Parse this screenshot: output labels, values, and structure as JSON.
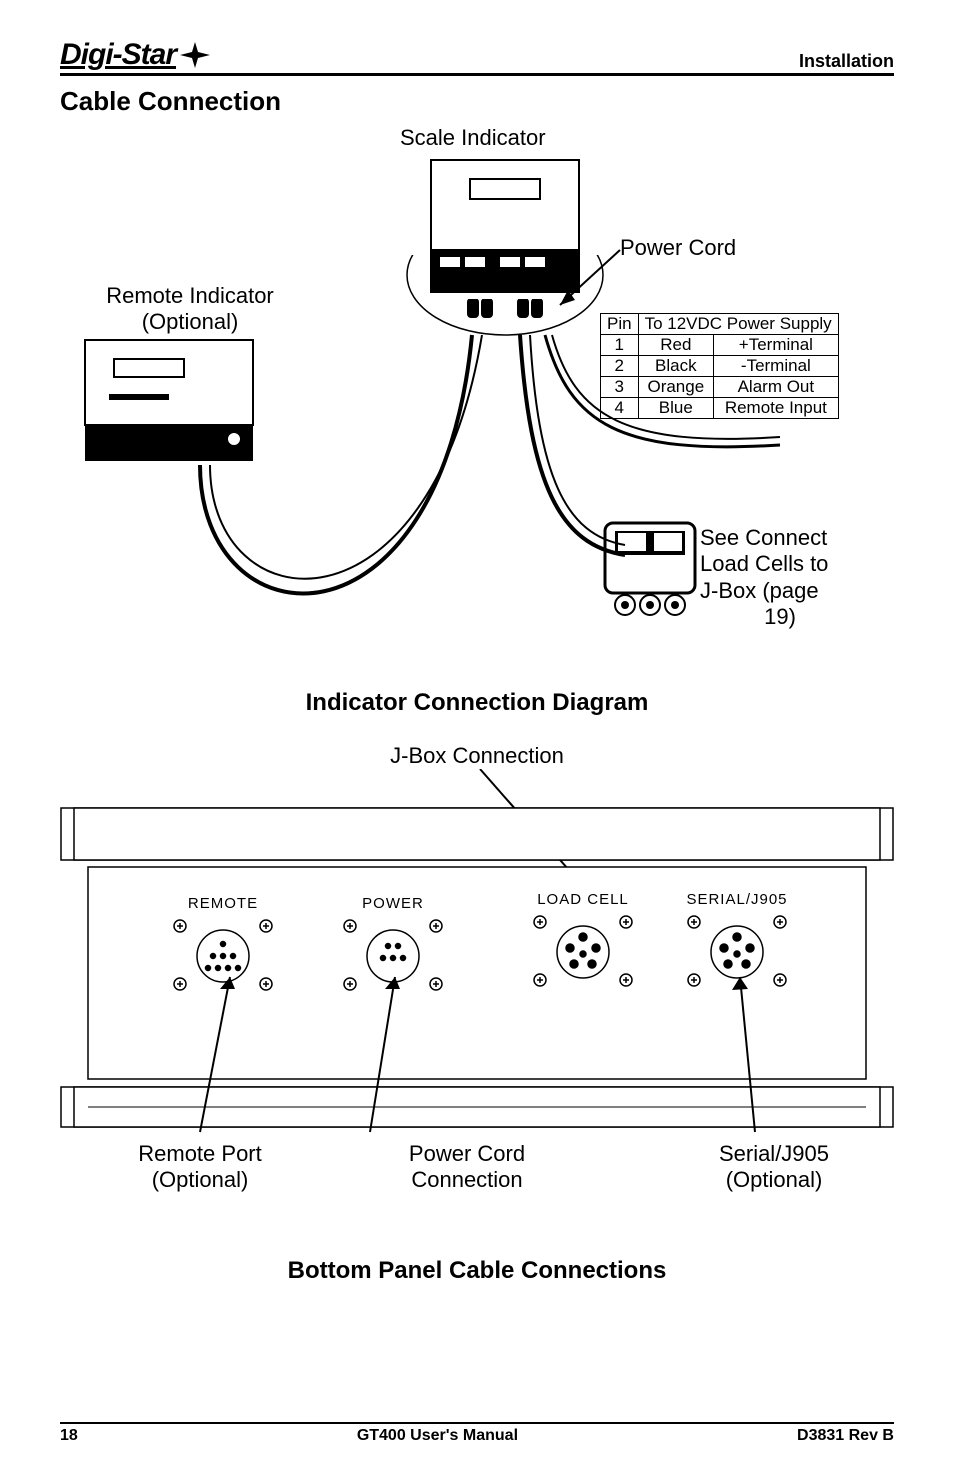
{
  "header": {
    "logo_text": "Digi-Star",
    "section": "Installation"
  },
  "titles": {
    "cable_connection": "Cable Connection",
    "indicator_diagram": "Indicator Connection Diagram",
    "jbox_connection": "J-Box Connection",
    "bottom_panel": "Bottom Panel Cable Connections"
  },
  "labels": {
    "scale_indicator": "Scale Indicator",
    "power_cord": "Power Cord",
    "remote_indicator_l1": "Remote Indicator",
    "remote_indicator_l2": "(Optional)",
    "jbox_note_l1": "See Connect",
    "jbox_note_l2": "Load Cells to",
    "jbox_note_l3": "J-Box (page",
    "jbox_note_l4": "19)",
    "remote_port_l1": "Remote Port",
    "remote_port_l2": "(Optional)",
    "power_cord_conn_l1": "Power Cord",
    "power_cord_conn_l2": "Connection",
    "serial_l1": "Serial/J905",
    "serial_l2": "(Optional)"
  },
  "pin_table": {
    "header_pin": "Pin",
    "header_desc": "To 12VDC Power Supply",
    "rows": [
      {
        "pin": "1",
        "color": "Red",
        "desc": "+Terminal"
      },
      {
        "pin": "2",
        "color": "Black",
        "desc": "-Terminal"
      },
      {
        "pin": "3",
        "color": "Orange",
        "desc": "Alarm Out"
      },
      {
        "pin": "4",
        "color": "Blue",
        "desc": "Remote Input"
      }
    ]
  },
  "ports": {
    "remote": "REMOTE",
    "power": "POWER",
    "load_cell": "LOAD CELL",
    "serial": "SERIAL/J905"
  },
  "footer": {
    "page": "18",
    "manual": "GT400 User's Manual",
    "doc": "D3831 Rev B"
  }
}
